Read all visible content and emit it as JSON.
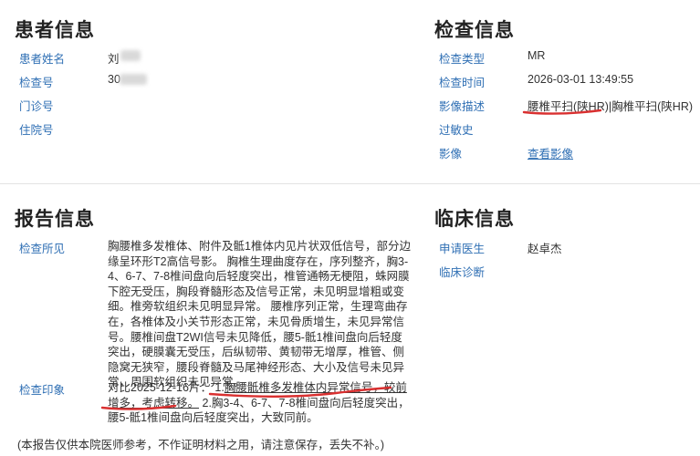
{
  "patient": {
    "title": "患者信息",
    "name_label": "患者姓名",
    "name_value": "刘",
    "exam_no_label": "检查号",
    "exam_no_value": "30",
    "outpatient_label": "门诊号",
    "inpatient_label": "住院号"
  },
  "exam": {
    "title": "检查信息",
    "type_label": "检查类型",
    "type_value": "MR",
    "time_label": "检查时间",
    "time_value": "2026-03-01 13:49:55",
    "desc_label": "影像描述",
    "desc_value": "腰椎平扫(陕HR)|胸椎平扫(陕HR)",
    "allergy_label": "过敏史",
    "image_label": "影像",
    "image_link": "查看影像"
  },
  "report": {
    "title": "报告信息",
    "findings_label": "检查所见",
    "findings_text": "胸腰椎多发椎体、附件及骶1椎体内见片状双低信号，部分边缘呈环形T2高信号影。 胸椎生理曲度存在，序列整齐，胸3-4、6-7、7-8椎间盘向后轻度突出，椎管通畅无梗阻，蛛网膜下腔无受压，胸段脊髓形态及信号正常，未见明显增粗或变细。椎旁软组织未见明显异常。 腰椎序列正常，生理弯曲存在，各椎体及小关节形态正常，未见骨质增生，未见异常信号。腰椎间盘T2WI信号未见降低，腰5-骶1椎间盘向后轻度突出，硬膜囊无受压，后纵韧带、黄韧带无增厚，椎管、侧隐窝无狭窄，腰段脊髓及马尾神经形态、大小及信号未见异常，周围软组织未见异常。",
    "impression_label": "检查印象",
    "impression_prefix": "对比2025-12-16片： 1.",
    "impression_underlined": "胸腰骶椎多发椎体内异常信号，较前增多，考虑转移。",
    "impression_rest": " 2.胸3-4、6-7、7-8椎间盘向后轻度突出，腰5-骶1椎间盘向后轻度突出，大致同前。",
    "disclaimer": "(本报告仅供本院医师参考，不作证明材料之用，请注意保存，丢失不补。)"
  },
  "clinical": {
    "title": "临床信息",
    "doctor_label": "申请医生",
    "doctor_value": "赵卓杰",
    "diagnosis_label": "临床诊断"
  },
  "colors": {
    "label": "#2f6fb4",
    "annotation": "#d93030"
  }
}
